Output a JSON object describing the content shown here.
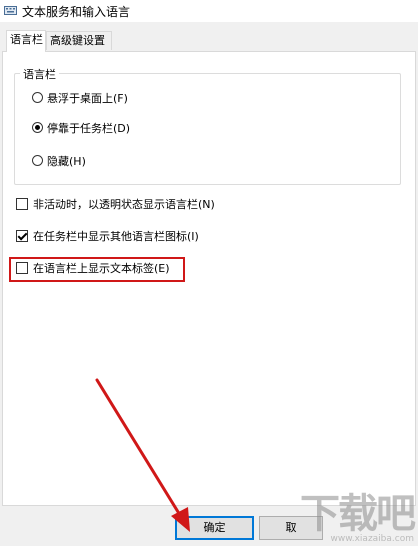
{
  "window": {
    "title": "文本服务和输入语言"
  },
  "tabs": [
    {
      "label": "语言栏",
      "active": true
    },
    {
      "label": "高级键设置",
      "active": false
    }
  ],
  "language_bar": {
    "group_label": "语言栏",
    "options": [
      {
        "label": "悬浮于桌面上(F)",
        "selected": false
      },
      {
        "label": "停靠于任务栏(D)",
        "selected": true
      },
      {
        "label": "隐藏(H)",
        "selected": false
      }
    ]
  },
  "checkboxes": [
    {
      "label": "非活动时，以透明状态显示语言栏(N)",
      "checked": false
    },
    {
      "label": "在任务栏中显示其他语言栏图标(I)",
      "checked": true
    },
    {
      "label": "在语言栏上显示文本标签(E)",
      "checked": false
    }
  ],
  "buttons": {
    "ok": "确定",
    "cancel": "取"
  },
  "watermark": {
    "title": "下载吧",
    "subtitle": "www.xiazaiba.com"
  },
  "colors": {
    "highlight": "#d01818",
    "arrow": "#d01818",
    "default_button_border": "#0078d7"
  }
}
